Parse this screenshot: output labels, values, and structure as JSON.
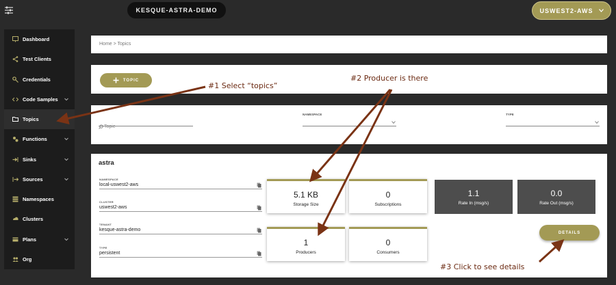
{
  "header": {
    "cluster_name": "KESQUE-ASTRA-DEMO",
    "region": "USWEST2-AWS"
  },
  "sidebar": {
    "items": [
      {
        "label": "Dashboard",
        "icon": "monitor-icon",
        "has_chevron": false
      },
      {
        "label": "Test Clients",
        "icon": "share-icon",
        "has_chevron": false
      },
      {
        "label": "Credentials",
        "icon": "key-icon",
        "has_chevron": false
      },
      {
        "label": "Code Samples",
        "icon": "code-icon",
        "has_chevron": true
      },
      {
        "label": "Topics",
        "icon": "folder-icon",
        "has_chevron": false,
        "active": true
      },
      {
        "label": "Functions",
        "icon": "functions-icon",
        "has_chevron": true
      },
      {
        "label": "Sinks",
        "icon": "sink-icon",
        "has_chevron": true
      },
      {
        "label": "Sources",
        "icon": "source-icon",
        "has_chevron": true
      },
      {
        "label": "Namespaces",
        "icon": "namespaces-icon",
        "has_chevron": false
      },
      {
        "label": "Clusters",
        "icon": "clusters-icon",
        "has_chevron": false
      },
      {
        "label": "Plans",
        "icon": "plans-icon",
        "has_chevron": true
      },
      {
        "label": "Org",
        "icon": "org-icon",
        "has_chevron": false
      }
    ]
  },
  "breadcrumb": "Home > Topics",
  "add_topic_label": "TOPIC",
  "filters": {
    "topic_placeholder": "Topic",
    "namespace_label": "NAMESPACE",
    "type_label": "TYPE"
  },
  "topic": {
    "name": "astra",
    "namespace_label": "NAMESPACE",
    "namespace": "local-uswest2-aws",
    "cluster_label": "CLUSTER",
    "cluster": "uswest2-aws",
    "tenant_label": "TENANT",
    "tenant": "kesque-astra-demo",
    "type_label": "TYPE",
    "type": "persistent"
  },
  "stats": {
    "storage_size": "5.1 KB",
    "storage_size_label": "Storage Size",
    "subscriptions": "0",
    "subscriptions_label": "Subscriptions",
    "rate_in": "1.1",
    "rate_in_label": "Rate In (msg/s)",
    "rate_out": "0.0",
    "rate_out_label": "Rate Out (msg/s)",
    "producers": "1",
    "producers_label": "Producers",
    "consumers": "0",
    "consumers_label": "Consumers"
  },
  "details_label": "DETAILS",
  "annotations": {
    "step1": "#1 Select “topics”",
    "step2": "#2 Producer is there",
    "step3": "#3 Click to see details"
  },
  "colors": {
    "accent": "#a39a55",
    "annotation": "#7a3315",
    "background": "#2a2a2a",
    "sidebar": "#1c1c1c",
    "dark_card": "#4d4d4d"
  }
}
